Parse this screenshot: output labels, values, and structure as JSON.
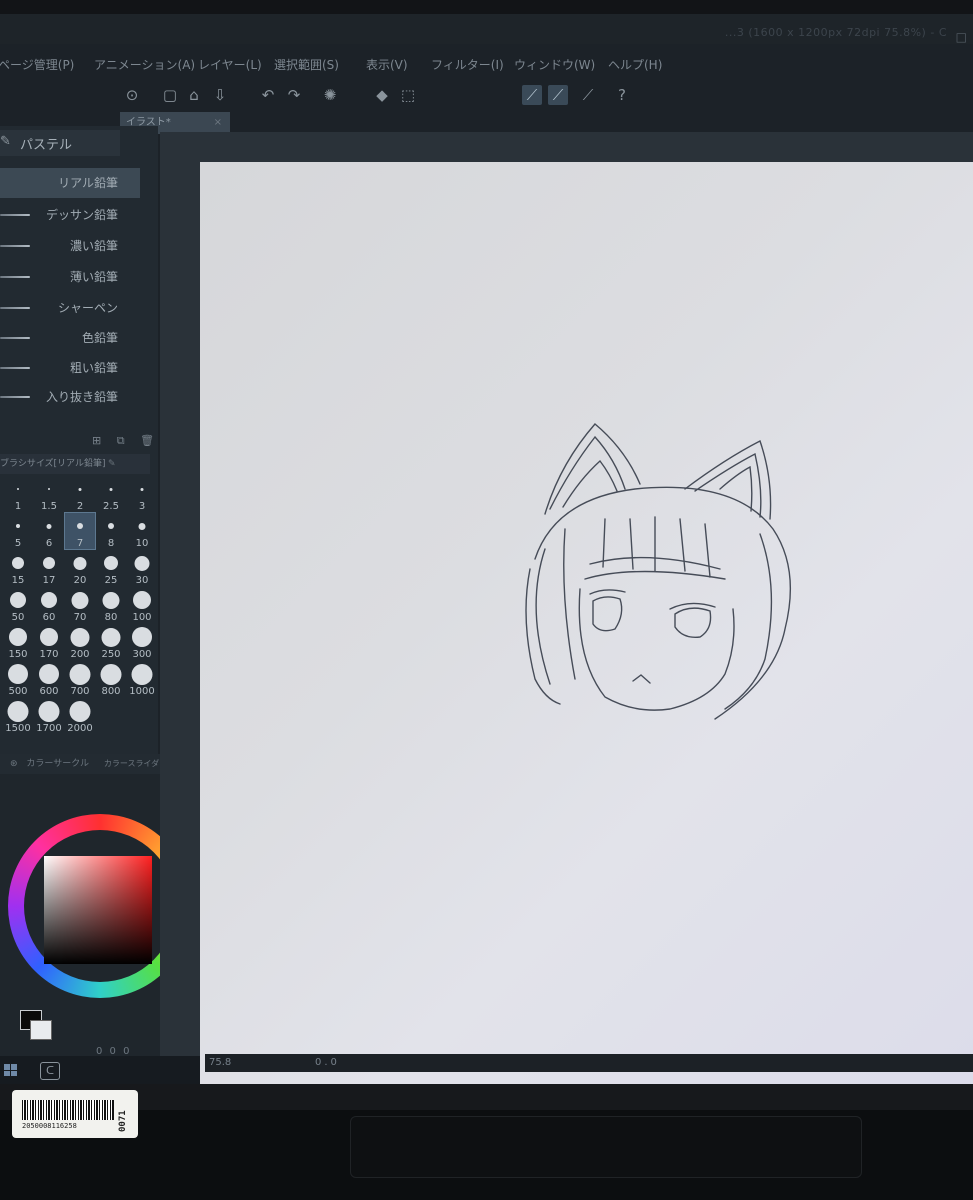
{
  "window": {
    "title": "...3 (1600 x 1200px 72dpi 75.8%) - C",
    "win_controls": "□"
  },
  "menu": [
    "ページ管理(P)",
    "アニメーション(A)",
    "レイヤー(L)",
    "選択範囲(S)",
    "表示(V)",
    "フィルター(I)",
    "ウィンドウ(W)",
    "ヘルプ(H)"
  ],
  "toolbar": {
    "icons": [
      "com-icon",
      "new-file-icon",
      "open-icon",
      "save-icon",
      "undo-icon",
      "redo-icon",
      "loading-icon",
      "fill-icon",
      "transform-icon",
      "snap-ruler-icon",
      "snap-grid-icon",
      "snap-special-icon",
      "help-icon"
    ]
  },
  "document_tab": {
    "label": "イラスト*",
    "close": "×"
  },
  "subtool": {
    "tab_label": "パステル",
    "brushes": [
      "リアル鉛筆",
      "デッサン鉛筆",
      "濃い鉛筆",
      "薄い鉛筆",
      "シャーペン",
      "色鉛筆",
      "粗い鉛筆",
      "入り抜き鉛筆"
    ],
    "selected_index": 0,
    "actions": "⊞ ⧉ 🗑"
  },
  "brush_size": {
    "title": "ブラシサイズ[リアル鉛筆]",
    "rows": [
      [
        "1",
        "1.5",
        "2",
        "2.5",
        "3"
      ],
      [
        "5",
        "6",
        "7",
        "8",
        "10"
      ],
      [
        "15",
        "17",
        "20",
        "25",
        "30"
      ],
      [
        "50",
        "60",
        "70",
        "80",
        "100"
      ],
      [
        "150",
        "170",
        "200",
        "250",
        "300"
      ],
      [
        "500",
        "600",
        "700",
        "800",
        "1000"
      ],
      [
        "1500",
        "1700",
        "2000"
      ]
    ],
    "selected": "7"
  },
  "color": {
    "tab_label": "カラーサークル",
    "tab2_label": "カラースライダー",
    "main_color": "#0a0a0a",
    "sub_color": "#e9ecef",
    "status": "0 0 0"
  },
  "statusbar": {
    "zoom": "75.8",
    "position": "0.0"
  },
  "sticker": {
    "barcode_number": "2050008116258",
    "side_code": "0071"
  }
}
